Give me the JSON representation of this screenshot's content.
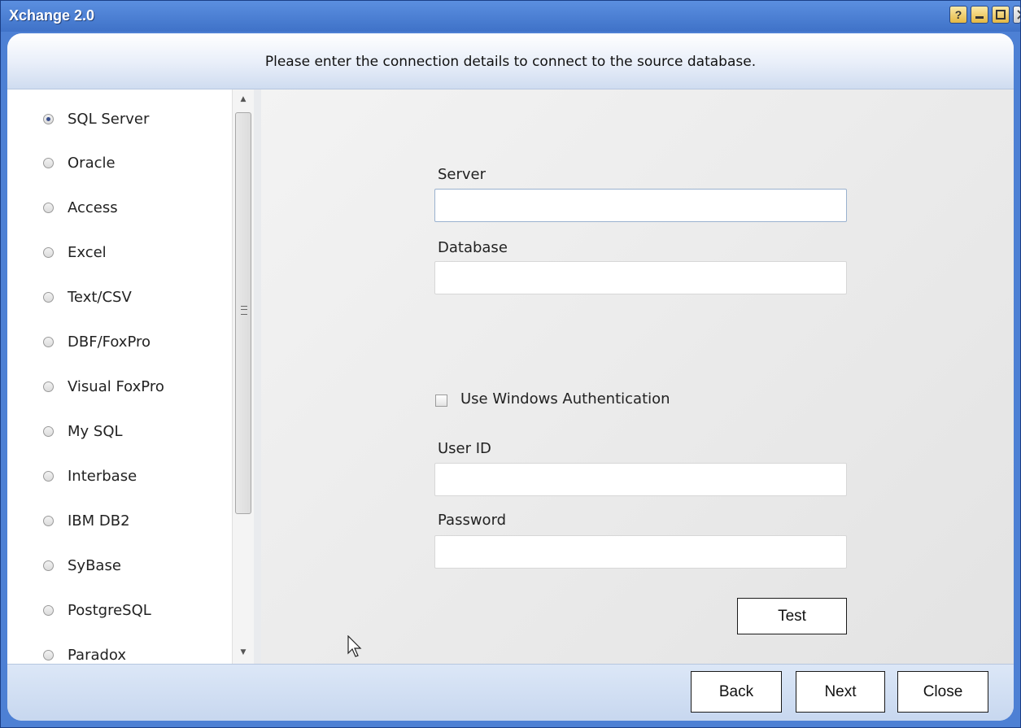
{
  "window": {
    "title": "Xchange 2.0",
    "controls": {
      "help_label": "?"
    }
  },
  "header": {
    "instruction": "Please enter the connection details to connect to the source database."
  },
  "sidebar": {
    "selected": "SQL Server",
    "items": [
      {
        "label": "SQL Server",
        "checked": true
      },
      {
        "label": "Oracle",
        "checked": false
      },
      {
        "label": "Access",
        "checked": false
      },
      {
        "label": "Excel",
        "checked": false
      },
      {
        "label": "Text/CSV",
        "checked": false
      },
      {
        "label": "DBF/FoxPro",
        "checked": false
      },
      {
        "label": "Visual FoxPro",
        "checked": false
      },
      {
        "label": "My SQL",
        "checked": false
      },
      {
        "label": "Interbase",
        "checked": false
      },
      {
        "label": "IBM DB2",
        "checked": false
      },
      {
        "label": "SyBase",
        "checked": false
      },
      {
        "label": "PostgreSQL",
        "checked": false
      },
      {
        "label": "Paradox",
        "checked": false
      }
    ]
  },
  "form": {
    "server": {
      "label": "Server",
      "value": ""
    },
    "database": {
      "label": "Database",
      "value": ""
    },
    "windows_auth": {
      "label": "Use Windows Authentication",
      "checked": false
    },
    "user_id": {
      "label": "User ID",
      "value": ""
    },
    "password": {
      "label": "Password",
      "value": ""
    },
    "test_label": "Test"
  },
  "footer": {
    "back_label": "Back",
    "next_label": "Next",
    "close_label": "Close"
  },
  "colors": {
    "titlebar": "#4d80d4",
    "header_gradient_end": "#cfdcf0",
    "footer": "#c7d7ef",
    "content_bg": "#e9e9e9"
  }
}
